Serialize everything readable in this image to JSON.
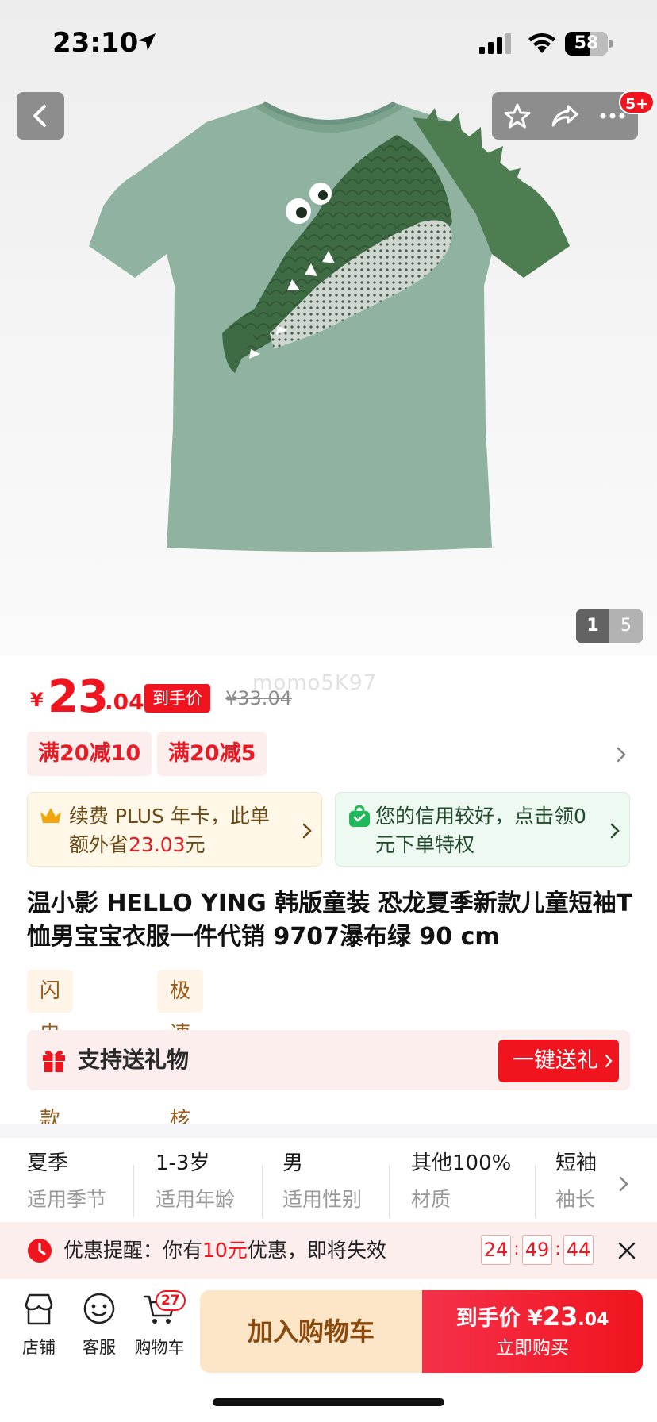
{
  "status_bar": {
    "time": "23:10",
    "battery": "58",
    "battery_level_percent": 58
  },
  "gallery": {
    "current": "1",
    "total": "5",
    "badge": "5+"
  },
  "price": {
    "currency": "¥",
    "integer": "23",
    "decimal": ".04",
    "tag": "到手价",
    "original": "¥33.04",
    "watermark": "momo5K97"
  },
  "coupons": [
    "满20减10",
    "满20减5"
  ],
  "promos": {
    "plus": {
      "before": "续费 PLUS 年卡，此单额外省",
      "amount": "23.03",
      "after": "元"
    },
    "credit": {
      "text": "您的信用较好，点击领0元下单特权"
    }
  },
  "product_title": "温小影 HELLO YING 韩版童装 恐龙夏季新款儿童短袖T恤男宝宝衣服一件代销 9707瀑布绿 90 cm",
  "service_tags": [
    "闪电退款",
    "极速审核"
  ],
  "gift": {
    "label": "支持送礼物",
    "button": "一键送礼"
  },
  "specs": [
    {
      "value": "夏季",
      "key": "适用季节"
    },
    {
      "value": "1-3岁",
      "key": "适用年龄"
    },
    {
      "value": "男",
      "key": "适用性别"
    },
    {
      "value": "其他100%",
      "key": "材质"
    },
    {
      "value": "短袖",
      "key": "袖长"
    }
  ],
  "reminder": {
    "prefix": "优惠提醒：你有",
    "amount": "10元",
    "suffix": "优惠，即将失效",
    "hours": "24",
    "minutes": "49",
    "seconds": "44",
    "separator": ":"
  },
  "bottom_nav": {
    "store": "店铺",
    "service": "客服",
    "cart": "购物车",
    "cart_count": "27",
    "add_to_cart": "加入购物车",
    "buy_label": "到手价",
    "buy_currency": "¥",
    "buy_price_int": "23",
    "buy_price_dec": ".04",
    "buy_now": "立即购买"
  },
  "colors": {
    "accent": "#f0141e",
    "plus_gold": "#f2a50c",
    "credit_green": "#1fb85a"
  }
}
